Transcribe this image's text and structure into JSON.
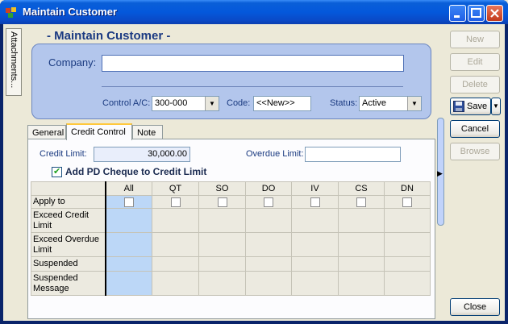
{
  "window": {
    "title": "Maintain Customer"
  },
  "side_tab": {
    "label": "Attachments..."
  },
  "form": {
    "heading": "- Maintain Customer -",
    "company_label": "Company:",
    "company_value": "",
    "control_ac_label": "Control A/C:",
    "control_ac_value": "300-000",
    "code_label": "Code:",
    "code_value": "<<New>>",
    "status_label": "Status:",
    "status_value": "Active"
  },
  "tabs": [
    {
      "label": "General"
    },
    {
      "label": "Credit Control"
    },
    {
      "label": "Note"
    }
  ],
  "credit": {
    "credit_limit_label": "Credit Limit:",
    "credit_limit_value": "30,000.00",
    "overdue_limit_label": "Overdue Limit:",
    "overdue_limit_value": "",
    "pd_cheque_label": "Add PD Cheque to Credit Limit",
    "pd_cheque_checked": true
  },
  "grid": {
    "columns": [
      "All",
      "QT",
      "SO",
      "DO",
      "IV",
      "CS",
      "DN"
    ],
    "rows": [
      {
        "label": "Apply to",
        "checks": [
          false,
          false,
          false,
          false,
          false,
          false,
          false
        ]
      },
      {
        "label": "Exceed Credit Limit"
      },
      {
        "label": "Exceed Overdue Limit"
      },
      {
        "label": "Suspended"
      },
      {
        "label": "Suspended Message"
      }
    ]
  },
  "buttons": {
    "new": "New",
    "edit": "Edit",
    "delete": "Delete",
    "save": "Save",
    "cancel": "Cancel",
    "browse": "Browse",
    "close": "Close"
  }
}
